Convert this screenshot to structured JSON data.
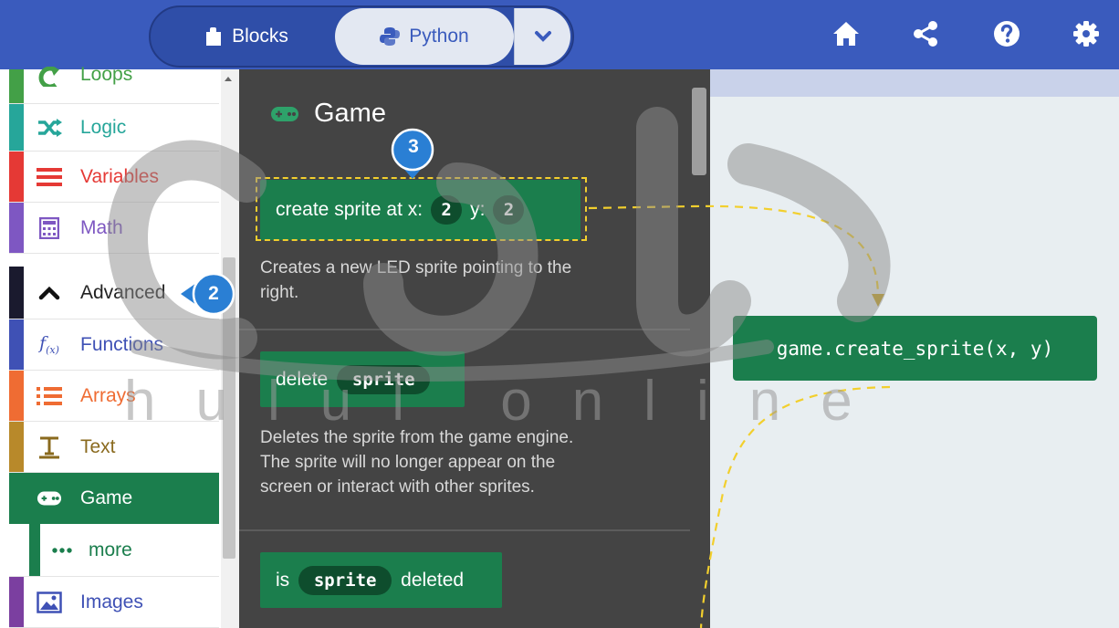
{
  "toolbar": {
    "blocks_label": "Blocks",
    "python_label": "Python",
    "colors": {
      "bar": "#3a5bbd",
      "toggle_active_bg": "#e3e8f2"
    },
    "icons": [
      "home-icon",
      "share-icon",
      "help-icon",
      "settings-icon"
    ]
  },
  "sidebar": {
    "items": [
      {
        "label": "Loops",
        "color": "#43a047",
        "icon": "loop-icon"
      },
      {
        "label": "Logic",
        "color": "#26a69a",
        "icon": "shuffle-icon"
      },
      {
        "label": "Variables",
        "color": "#e53935",
        "icon": "list-lines-icon"
      },
      {
        "label": "Math",
        "color": "#7e57c2",
        "icon": "calculator-icon"
      },
      {
        "label": "Advanced",
        "color": "#1a1a2e",
        "icon": "chevron-up-icon"
      },
      {
        "label": "Functions",
        "color": "#3f51b5",
        "icon": "function-icon"
      },
      {
        "label": "Arrays",
        "color": "#ef6c33",
        "icon": "numbered-list-icon"
      },
      {
        "label": "Text",
        "color": "#b8892a",
        "icon": "text-icon"
      },
      {
        "label": "Game",
        "color": "#1b7e4d",
        "icon": "gamepad-icon"
      },
      {
        "label": "more",
        "color": "#1b7e4d",
        "icon": "more-dots-icon"
      },
      {
        "label": "Images",
        "color": "#7b3fa0",
        "icon": "image-icon"
      }
    ]
  },
  "flyout": {
    "title": "Game",
    "blocks": [
      {
        "parts": [
          "create sprite at x:",
          "2",
          "y:",
          "2"
        ],
        "description": [
          "Creates a new LED sprite pointing to the",
          "right."
        ]
      },
      {
        "parts": [
          "delete",
          "sprite"
        ],
        "description": [
          "Deletes the sprite from the game engine.",
          "The sprite will no longer appear on the",
          "screen or interact with other sprites."
        ]
      },
      {
        "parts": [
          "is",
          "sprite",
          "deleted"
        ]
      }
    ]
  },
  "workspace": {
    "code": "game.create_sprite(x, y)"
  },
  "callouts": {
    "step2": "2",
    "step3": "3",
    "color": "#2a7fd4"
  },
  "watermark": {
    "latin": "hulul online"
  }
}
